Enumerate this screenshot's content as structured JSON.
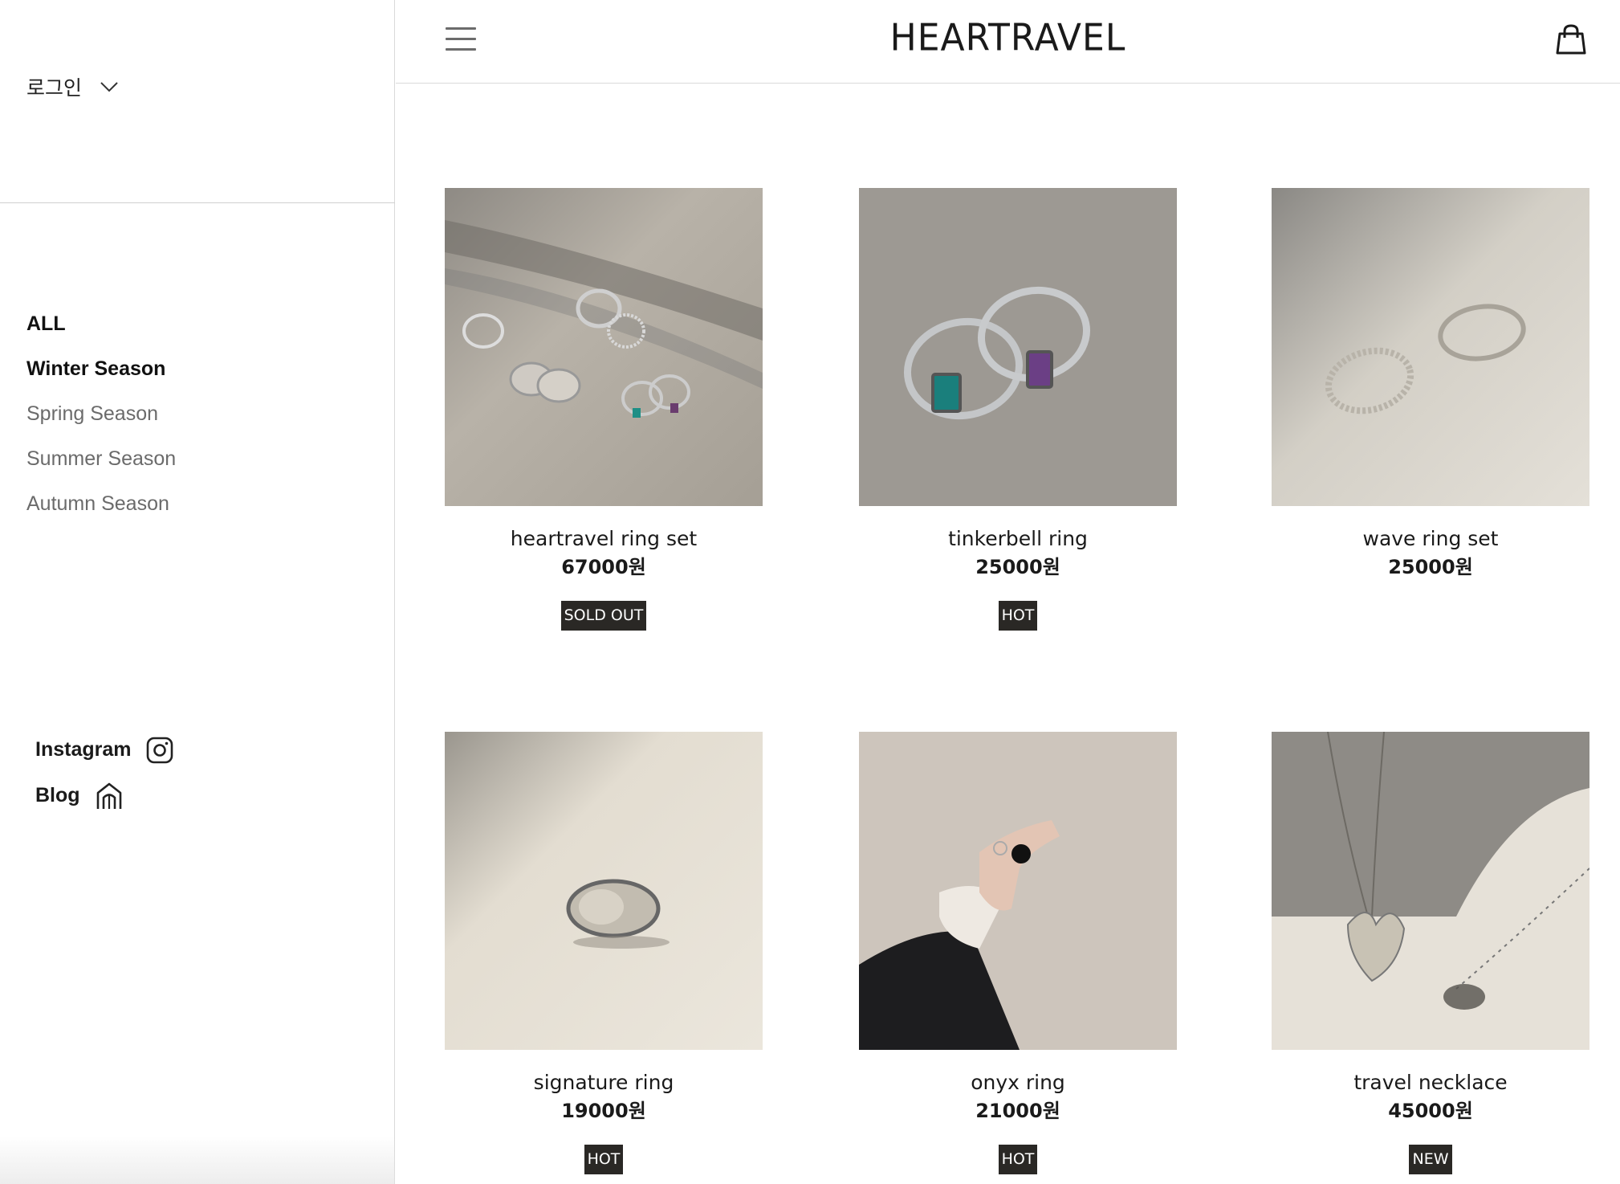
{
  "sidebar": {
    "login_label": "로그인",
    "categories": [
      {
        "label": "ALL",
        "bold": true
      },
      {
        "label": "Winter Season",
        "bold": true
      },
      {
        "label": "Spring Season",
        "bold": false
      },
      {
        "label": "Summer Season",
        "bold": false
      },
      {
        "label": "Autumn Season",
        "bold": false
      }
    ],
    "social": [
      {
        "label": "Instagram",
        "icon": "instagram-icon"
      },
      {
        "label": "Blog",
        "icon": "blog-house-icon"
      }
    ]
  },
  "header": {
    "logo": "HEARTRAVEL",
    "menu_icon": "hamburger-menu-icon",
    "cart_icon": "shopping-bag-icon"
  },
  "products": [
    {
      "name": "heartravel ring set",
      "price": "67000원",
      "badge": "SOLD OUT",
      "image": "rings on sand"
    },
    {
      "name": "tinkerbell ring",
      "price": "25000원",
      "badge": "HOT",
      "image": "two rings with stones on sand"
    },
    {
      "name": "wave ring set",
      "price": "25000원",
      "badge": "",
      "image": "two rings on beige surface"
    },
    {
      "name": "signature ring",
      "price": "19000원",
      "badge": "HOT",
      "image": "signet ring in light"
    },
    {
      "name": "onyx ring",
      "price": "21000원",
      "badge": "HOT",
      "image": "hand wearing onyx ring"
    },
    {
      "name": "travel necklace",
      "price": "45000원",
      "badge": "NEW",
      "image": "heart pendant necklace"
    }
  ],
  "colors": {
    "badge_bg": "#2a2825",
    "text": "#1a1a1a",
    "muted": "#6b6b6b",
    "border": "#d9d9d9"
  }
}
